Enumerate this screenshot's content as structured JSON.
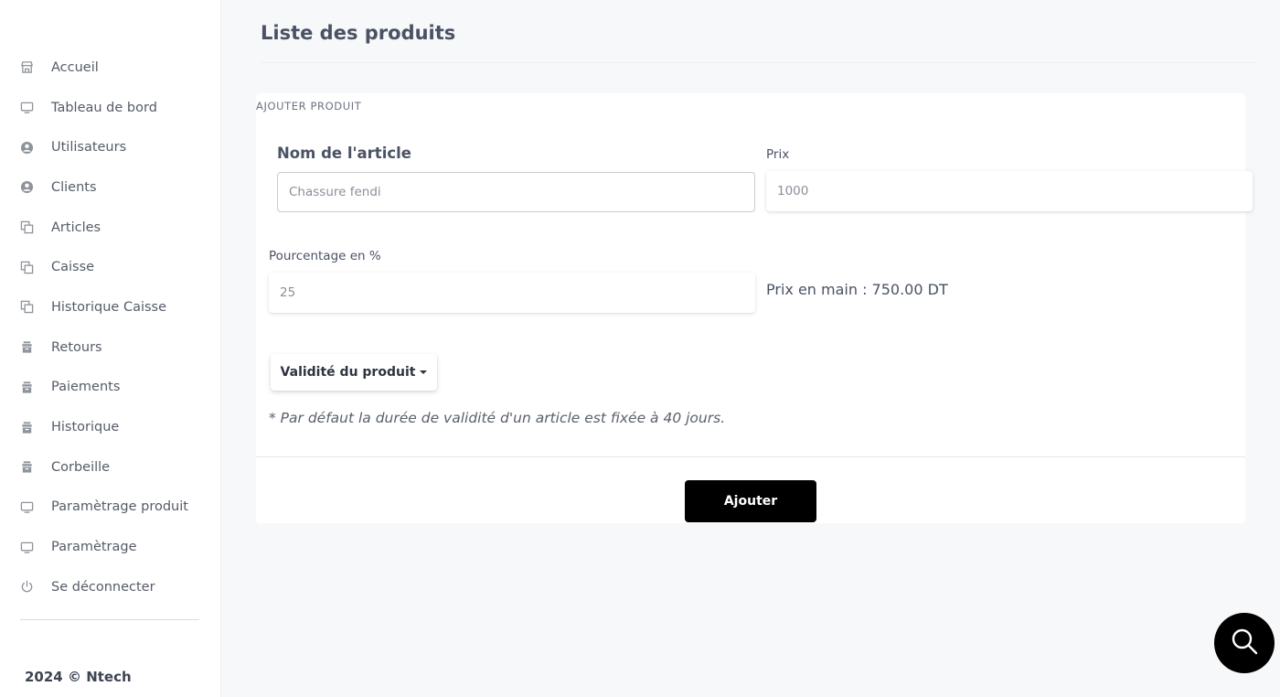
{
  "sidebar": {
    "items": [
      {
        "label": "Accueil",
        "icon": "store-icon"
      },
      {
        "label": "Tableau de bord",
        "icon": "monitor-icon"
      },
      {
        "label": "Utilisateurs",
        "icon": "user-circle-icon"
      },
      {
        "label": "Clients",
        "icon": "user-circle-icon"
      },
      {
        "label": "Articles",
        "icon": "copy-icon"
      },
      {
        "label": "Caisse",
        "icon": "copy-icon"
      },
      {
        "label": "Historique Caisse",
        "icon": "copy-icon"
      },
      {
        "label": "Retours",
        "icon": "box-icon"
      },
      {
        "label": "Paiements",
        "icon": "box-icon"
      },
      {
        "label": "Historique",
        "icon": "box-icon"
      },
      {
        "label": "Corbeille",
        "icon": "box-icon"
      },
      {
        "label": "Paramètrage produit",
        "icon": "monitor-icon"
      },
      {
        "label": "Paramètrage",
        "icon": "monitor-icon"
      },
      {
        "label": "Se déconnecter",
        "icon": "power-icon"
      }
    ],
    "footer": "2024 © Ntech"
  },
  "header": {
    "title": "Liste des produits"
  },
  "form": {
    "section_title": "AJOUTER PRODUIT",
    "nom_label": "Nom de l'article",
    "nom_value": "Chassure fendi",
    "prix_label": "Prix",
    "prix_value": "1000",
    "pourcentage_label": "Pourcentage en %",
    "pourcentage_value": "25",
    "prix_en_main": "Prix en main : 750.00 DT",
    "validite_button": "Validité du produit",
    "note": "* Par défaut la durée de validité d'un article est fixée à 40 jours.",
    "submit_button": "Ajouter"
  },
  "fab": {
    "icon": "search-icon"
  },
  "colors": {
    "icon": "#8e939c",
    "primary_button": "#000000",
    "text": "#4a5263"
  }
}
